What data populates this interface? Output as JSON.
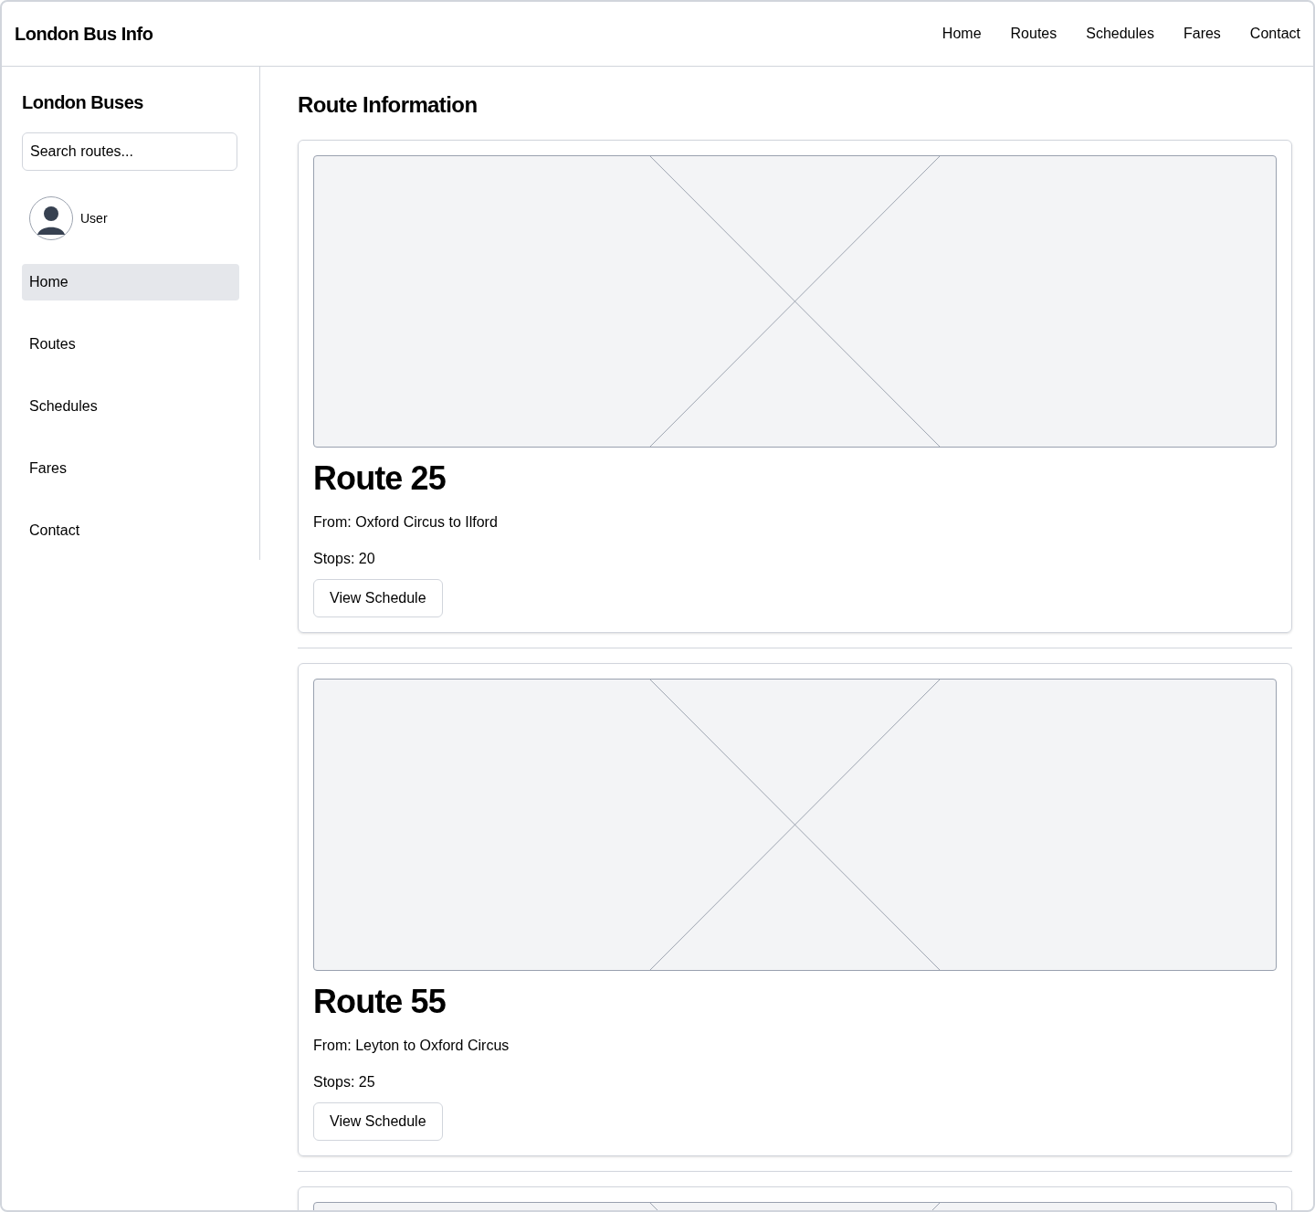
{
  "header": {
    "title": "London Bus Info",
    "nav": [
      {
        "label": "Home"
      },
      {
        "label": "Routes"
      },
      {
        "label": "Schedules"
      },
      {
        "label": "Fares"
      },
      {
        "label": "Contact"
      }
    ]
  },
  "sidebar": {
    "title": "London Buses",
    "search": {
      "placeholder": "Search routes..."
    },
    "user": {
      "name": "User"
    },
    "items": [
      {
        "label": "Home",
        "selected": true
      },
      {
        "label": "Routes",
        "selected": false
      },
      {
        "label": "Schedules",
        "selected": false
      },
      {
        "label": "Fares",
        "selected": false
      },
      {
        "label": "Contact",
        "selected": false
      }
    ]
  },
  "main": {
    "title": "Route Information",
    "cards": [
      {
        "kind": "route",
        "title": "Route 25",
        "from": "From: Oxford Circus to Ilford",
        "stops": "Stops: 20",
        "button": "View Schedule"
      },
      {
        "kind": "route",
        "title": "Route 55",
        "from": "From: Leyton to Oxford Circus",
        "stops": "Stops: 25",
        "button": "View Schedule"
      },
      {
        "kind": "clipped"
      }
    ]
  }
}
